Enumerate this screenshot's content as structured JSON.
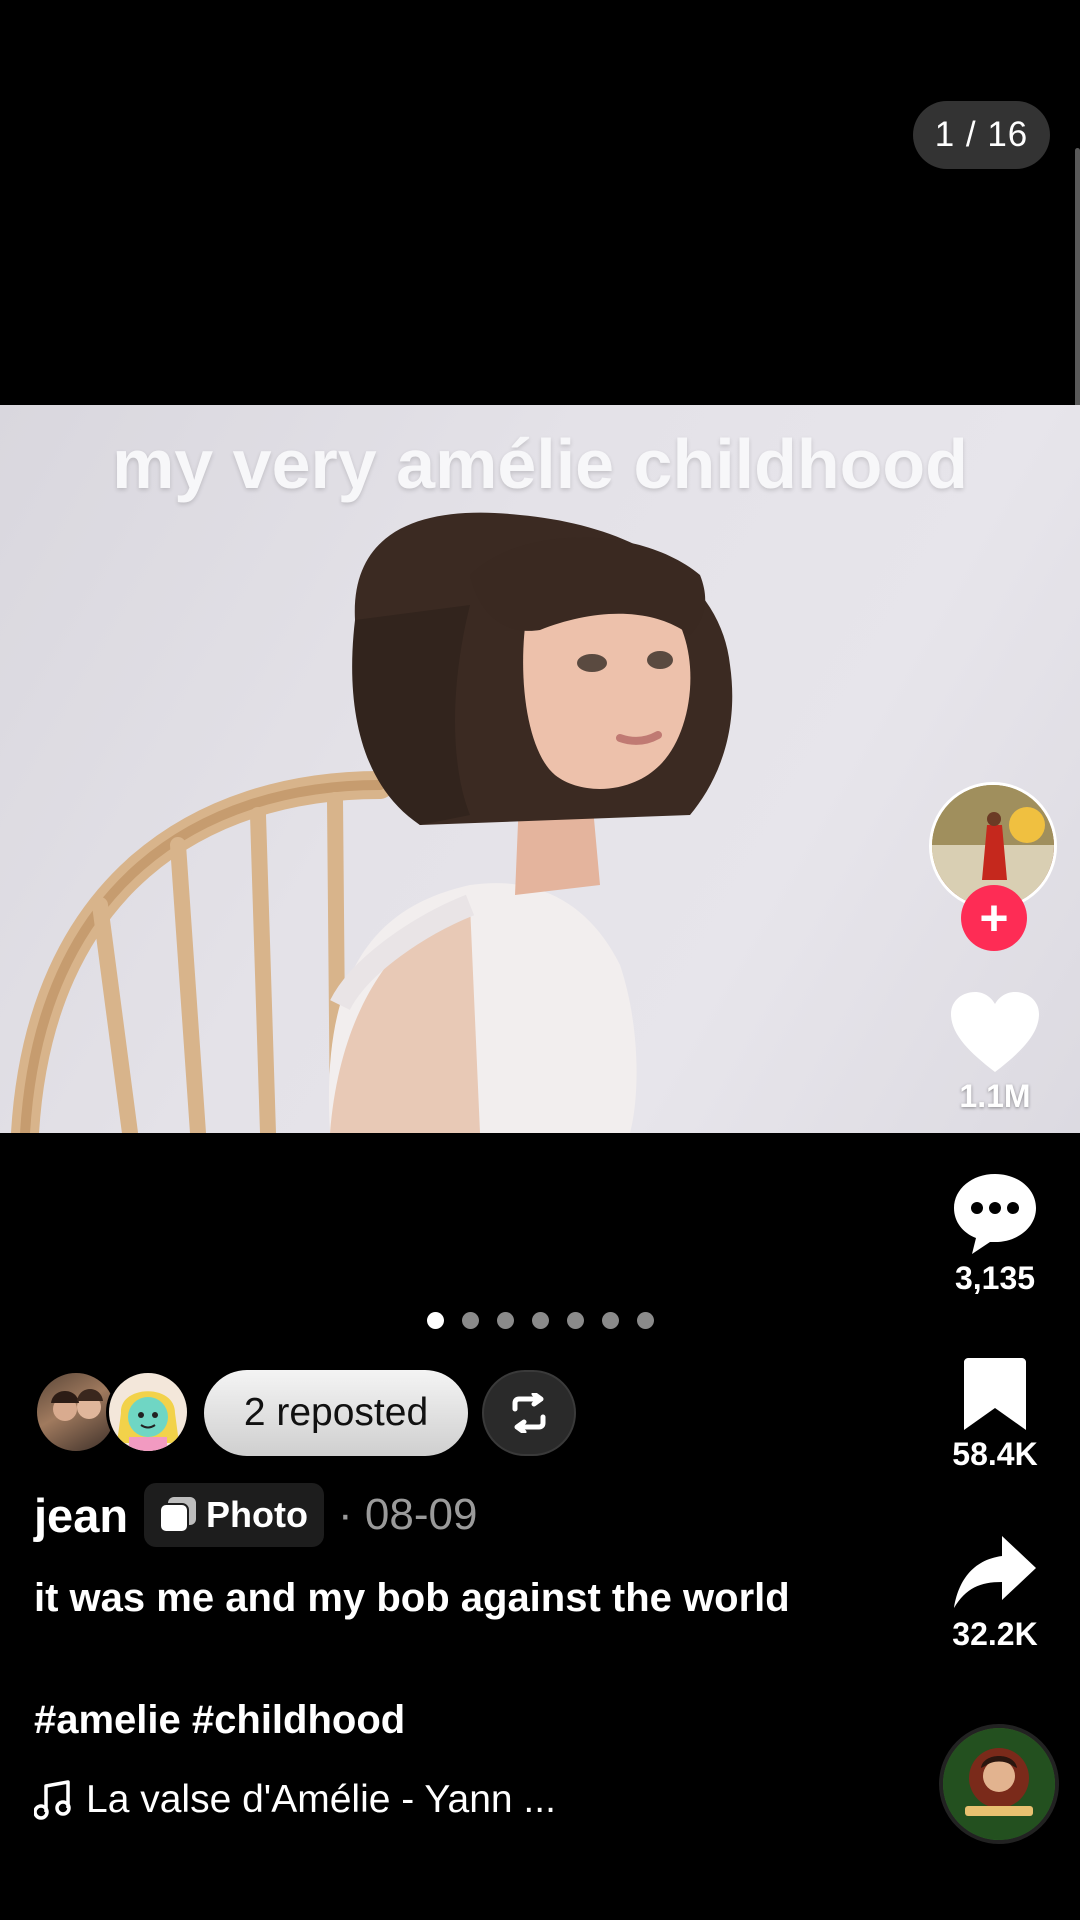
{
  "pager": {
    "counter": "1 / 16"
  },
  "photo": {
    "overlay_text": "my very amélie childhood"
  },
  "actions": {
    "likes": "1.1M",
    "comments": "3,135",
    "saves": "58.4K",
    "shares": "32.2K"
  },
  "carousel": {
    "dot_count": 7,
    "active_index": 0
  },
  "repost": {
    "label": "2 reposted"
  },
  "post": {
    "author": "jean",
    "badge": "Photo",
    "date": "· 08-09",
    "caption": "it was me and my bob against the world",
    "hashtags": "#amelie #childhood",
    "music": "La valse d'Amélie - Yann ..."
  },
  "colors": {
    "accent_follow": "#fe2c55",
    "background": "#000000"
  },
  "icons": {
    "follow": "plus-icon",
    "like": "heart-icon",
    "comment": "comment-bubble-icon",
    "save": "bookmark-icon",
    "share": "share-arrow-icon",
    "repost": "repost-icon",
    "photo": "photo-stack-icon",
    "music": "music-note-icon"
  }
}
